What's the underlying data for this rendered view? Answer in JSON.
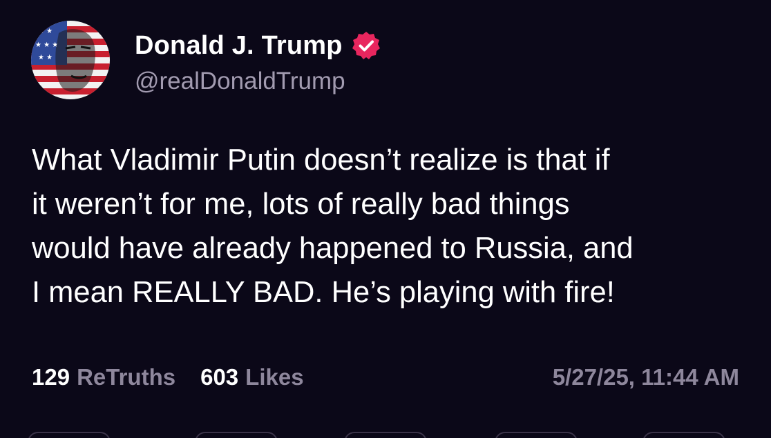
{
  "post": {
    "author": {
      "display_name": "Donald J. Trump",
      "handle": "@realDonaldTrump",
      "verified_icon": "verified-badge-icon",
      "badge_color": "#e8265e"
    },
    "text": "What Vladimir Putin doesn’t realize is that if\nit weren’t for me, lots of really bad things\nwould have already happened to Russia, and\nI mean REALLY BAD. He’s playing with fire!",
    "stats": {
      "retruths_count": "129",
      "retruths_label": "ReTruths",
      "likes_count": "603",
      "likes_label": "Likes"
    },
    "timestamp": "5/27/25, 11:44 AM"
  },
  "colors": {
    "background": "#0b0818",
    "primary_text": "#ffffff",
    "secondary_text": "#8e879c"
  },
  "action_bar": {
    "buttons": [
      "reply-button",
      "retruth-button",
      "like-button",
      "share-button",
      "more-button"
    ]
  }
}
